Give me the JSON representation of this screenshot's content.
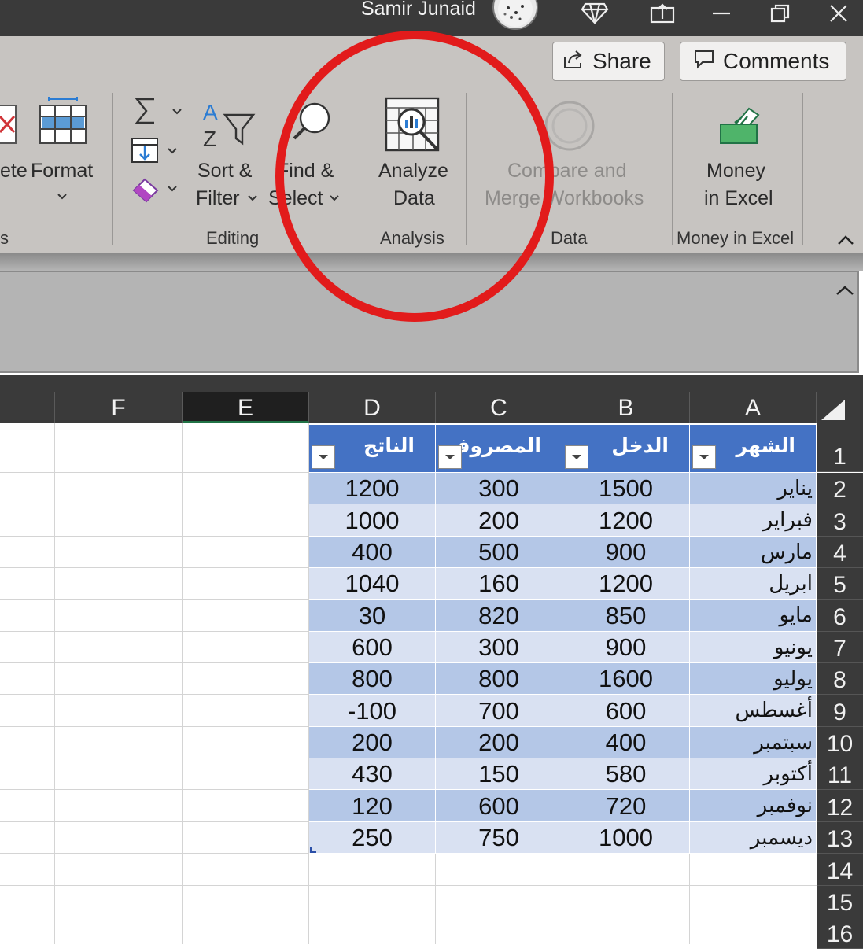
{
  "titlebar": {
    "user_name": "Samir Junaid",
    "icons": [
      "diamond-icon",
      "upload-icon",
      "minimize-icon",
      "restore-icon",
      "close-icon"
    ]
  },
  "header_buttons": {
    "share_label": "Share",
    "comments_label": "Comments"
  },
  "ribbon": {
    "delete_partial": "ete",
    "format_label": "Format",
    "cells_group_partial": "s",
    "sort_label_1": "Sort &",
    "sort_label_2": "Filter",
    "find_label_1": "Find &",
    "find_label_2": "Select",
    "editing_group": "Editing",
    "analyze_label_1": "Analyze",
    "analyze_label_2": "Data",
    "analysis_group": "Analysis",
    "compare_label_1": "Compare and",
    "compare_label_2": "Merge Workbooks",
    "data_group": "Data",
    "money_label_1": "Money",
    "money_label_2": "in Excel",
    "money_group": "Money in Excel"
  },
  "sheet": {
    "columns": [
      "F",
      "E",
      "D",
      "C",
      "B",
      "A"
    ],
    "selected_column": "E",
    "table_headers": {
      "month": "الشهر",
      "income": "الدخل",
      "expense": "المصروف",
      "net": "الناتج"
    },
    "rows": [
      {
        "num": "2",
        "month": "يناير",
        "income": "1500",
        "expense": "300",
        "net": "1200"
      },
      {
        "num": "3",
        "month": "فبراير",
        "income": "1200",
        "expense": "200",
        "net": "1000"
      },
      {
        "num": "4",
        "month": "مارس",
        "income": "900",
        "expense": "500",
        "net": "400"
      },
      {
        "num": "5",
        "month": "ابريل",
        "income": "1200",
        "expense": "160",
        "net": "1040"
      },
      {
        "num": "6",
        "month": "مايو",
        "income": "850",
        "expense": "820",
        "net": "30"
      },
      {
        "num": "7",
        "month": "يونيو",
        "income": "900",
        "expense": "300",
        "net": "600"
      },
      {
        "num": "8",
        "month": "يوليو",
        "income": "1600",
        "expense": "800",
        "net": "800"
      },
      {
        "num": "9",
        "month": "أغسطس",
        "income": "600",
        "expense": "700",
        "net": "-100"
      },
      {
        "num": "10",
        "month": "سبتمبر",
        "income": "400",
        "expense": "200",
        "net": "200"
      },
      {
        "num": "11",
        "month": "أكتوبر",
        "income": "580",
        "expense": "150",
        "net": "430"
      },
      {
        "num": "12",
        "month": "نوفمبر",
        "income": "720",
        "expense": "600",
        "net": "120"
      },
      {
        "num": "13",
        "month": "ديسمبر",
        "income": "1000",
        "expense": "750",
        "net": "250"
      }
    ],
    "row_header_1": "1",
    "empty_rows": [
      "14",
      "15",
      "16"
    ]
  },
  "colors": {
    "titlebar": "#3a3a3a",
    "ribbon": "#c7c4c1",
    "table_header": "#4472c4",
    "band_dark": "#b4c7e7",
    "band_light": "#d9e1f2",
    "annotation": "#e21b1b"
  }
}
